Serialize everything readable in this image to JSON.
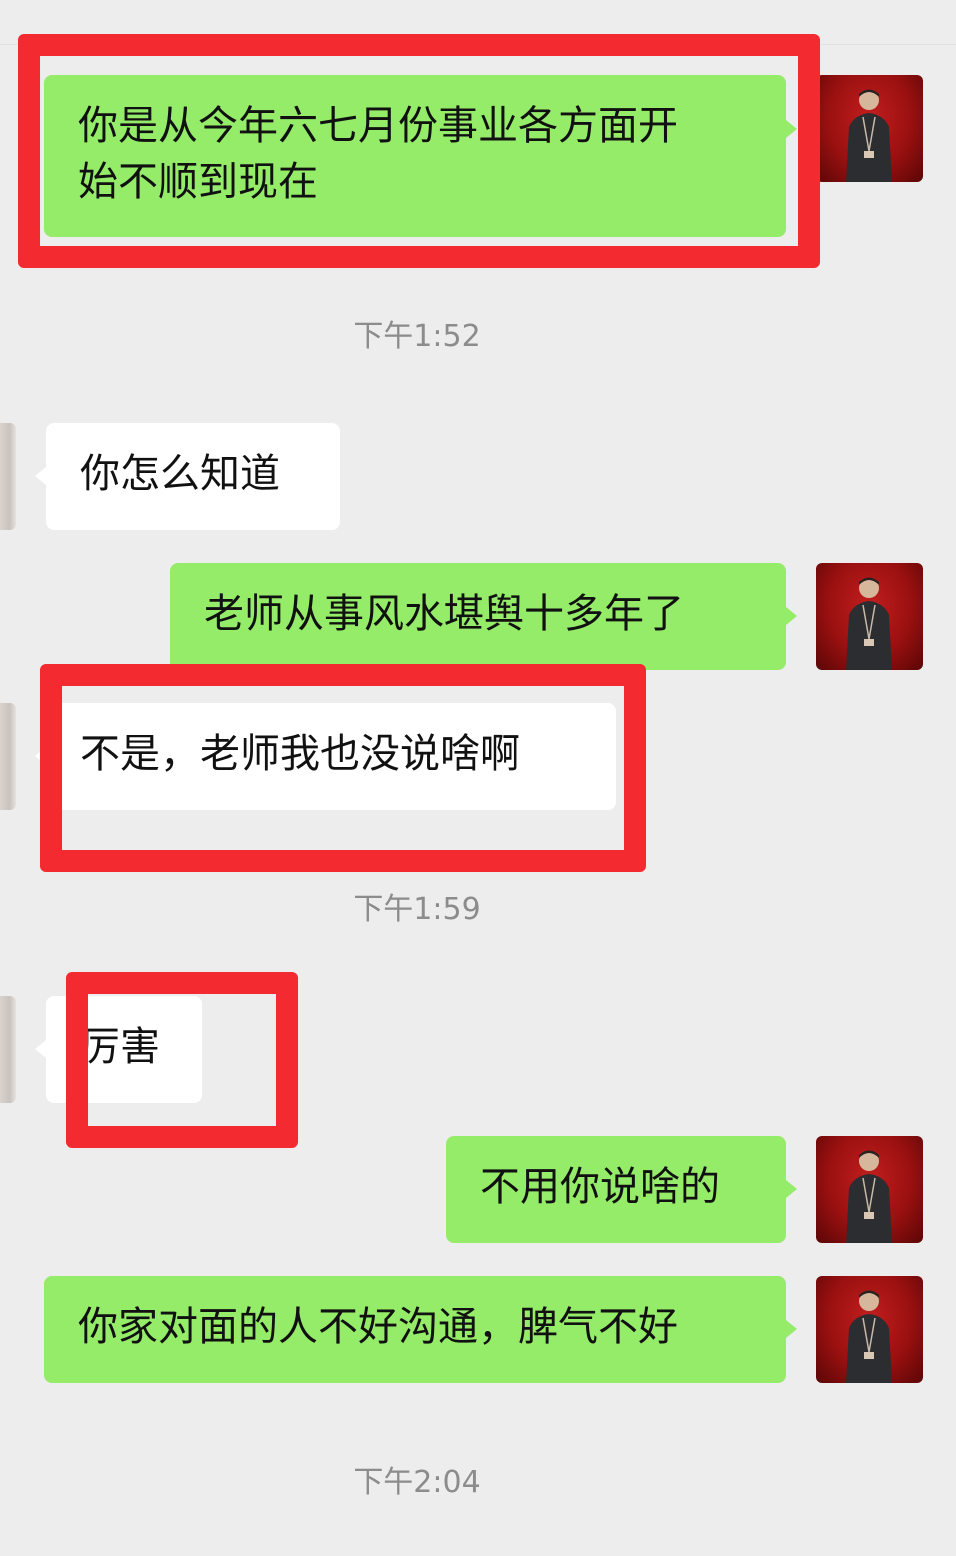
{
  "chat": {
    "messages": [
      {
        "sender": "self",
        "text": "你是从今年六七月份事业各方面开始不顺到现在",
        "line1": "你是从今年六七月份事业各方面开",
        "line2": "始不顺到现在"
      },
      {
        "type": "time",
        "text": "下午1:52"
      },
      {
        "sender": "other",
        "text": "你怎么知道"
      },
      {
        "sender": "self",
        "text": "老师从事风水堪舆十多年了"
      },
      {
        "sender": "other",
        "text": "不是，老师我也没说啥啊"
      },
      {
        "type": "time",
        "text": "下午1:59"
      },
      {
        "sender": "other",
        "text": "厉害"
      },
      {
        "sender": "self",
        "text": "不用你说啥的"
      },
      {
        "sender": "self",
        "text": "你家对面的人不好沟通，脾气不好"
      },
      {
        "type": "time",
        "text": "下午2:04"
      }
    ]
  },
  "colors": {
    "self_bubble": "#95ec69",
    "other_bubble": "#ffffff",
    "background": "#ededed",
    "highlight": "#f32a2f",
    "timestamp": "#8c8c8c"
  },
  "icons": {
    "self_avatar": "person-avatar-icon",
    "other_avatar": "contact-avatar-icon"
  }
}
